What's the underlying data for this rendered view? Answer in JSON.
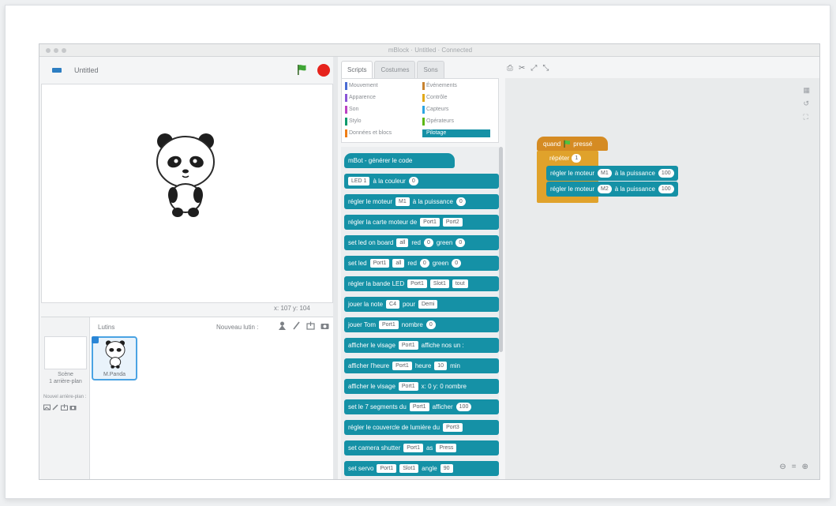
{
  "window": {
    "title": "mBlock · Untitled · Connected"
  },
  "stage": {
    "project_name": "Untitled",
    "coords": "x: 107  y: 104"
  },
  "sprites": {
    "title": "Lutins",
    "new_sprite_label": "Nouveau lutin :",
    "stage_label": "Scène\n1 arrière-plan",
    "bg_label": "Nouvel arrière-plan :",
    "items": [
      {
        "name": "M.Panda"
      }
    ]
  },
  "tabs": [
    {
      "label": "Scripts",
      "active": true
    },
    {
      "label": "Costumes",
      "active": false
    },
    {
      "label": "Sons",
      "active": false
    }
  ],
  "categories": [
    {
      "label": "Mouvement",
      "color": "#4a6cd4",
      "selected": false
    },
    {
      "label": "Apparence",
      "color": "#8a55d7",
      "selected": false
    },
    {
      "label": "Son",
      "color": "#bb42c3",
      "selected": false
    },
    {
      "label": "Stylo",
      "color": "#0e9a6c",
      "selected": false
    },
    {
      "label": "Données et blocs",
      "color": "#ee7d16",
      "selected": false
    },
    {
      "label": "Événements",
      "color": "#c88330",
      "selected": false
    },
    {
      "label": "Contrôle",
      "color": "#e1a91a",
      "selected": false
    },
    {
      "label": "Capteurs",
      "color": "#2ca5e2",
      "selected": false
    },
    {
      "label": "Opérateurs",
      "color": "#5cb712",
      "selected": false
    },
    {
      "label": "Pilotage",
      "color": "#1591a6",
      "selected": true
    }
  ],
  "palette": {
    "blocks": [
      {
        "parts": [
          {
            "t": "mBot - générer le code"
          }
        ]
      },
      {
        "parts": [
          {
            "s": "LED 1",
            "dd": true
          },
          {
            "t": "à la couleur"
          },
          {
            "s": "0"
          }
        ]
      },
      {
        "parts": [
          {
            "t": "régler le moteur"
          },
          {
            "s": "M1",
            "dd": true
          },
          {
            "t": "à la puissance"
          },
          {
            "s": "0"
          }
        ]
      },
      {
        "parts": [
          {
            "t": "régler la carte moteur de"
          },
          {
            "s": "Port1",
            "dd": true
          },
          {
            "s": "Port2",
            "dd": true
          }
        ]
      },
      {
        "parts": [
          {
            "t": "set led on board"
          },
          {
            "s": "all",
            "dd": true
          },
          {
            "t": "red"
          },
          {
            "s": "0"
          },
          {
            "t": "green"
          },
          {
            "s": "0"
          }
        ]
      },
      {
        "parts": [
          {
            "t": "set led"
          },
          {
            "s": "Port1",
            "dd": true
          },
          {
            "s": "all",
            "dd": true
          },
          {
            "t": "red"
          },
          {
            "s": "0"
          },
          {
            "t": "green"
          },
          {
            "s": "0"
          }
        ]
      },
      {
        "parts": [
          {
            "t": "régler la bande LED"
          },
          {
            "s": "Port1",
            "dd": true
          },
          {
            "s": "Slot1",
            "dd": true
          },
          {
            "s": "tout",
            "dd": true
          }
        ]
      },
      {
        "parts": [
          {
            "t": "jouer la note"
          },
          {
            "s": "C4",
            "dd": true
          },
          {
            "t": "pour"
          },
          {
            "s": "Demi",
            "dd": true
          }
        ]
      },
      {
        "parts": [
          {
            "t": "jouer Tom"
          },
          {
            "s": "Port1",
            "dd": true
          },
          {
            "t": "nombre"
          },
          {
            "s": "0"
          }
        ]
      },
      {
        "parts": [
          {
            "t": "afficher le visage"
          },
          {
            "s": "Port1",
            "dd": true
          },
          {
            "t": "affiche nos un :"
          }
        ]
      },
      {
        "parts": [
          {
            "t": "afficher l'heure"
          },
          {
            "s": "Port1",
            "dd": true
          },
          {
            "t": "heure"
          },
          {
            "s": "10",
            "dd": true
          },
          {
            "t": "min"
          }
        ]
      },
      {
        "parts": [
          {
            "t": "afficher le visage"
          },
          {
            "s": "Port1",
            "dd": true
          },
          {
            "t": "x: 0 y: 0 nombre"
          }
        ]
      },
      {
        "parts": [
          {
            "t": "set le 7 segments du"
          },
          {
            "s": "Port1",
            "dd": true
          },
          {
            "t": "afficher"
          },
          {
            "s": "100"
          }
        ]
      },
      {
        "parts": [
          {
            "t": "régler le couvercle de lumière du"
          },
          {
            "s": "Port3",
            "dd": true
          }
        ]
      },
      {
        "parts": [
          {
            "t": "set camera shutter"
          },
          {
            "s": "Port1",
            "dd": true
          },
          {
            "t": "as"
          },
          {
            "s": "Press",
            "dd": true
          }
        ]
      },
      {
        "parts": [
          {
            "t": "set servo"
          },
          {
            "s": "Port1",
            "dd": true
          },
          {
            "s": "Slot1",
            "dd": true
          },
          {
            "t": "angle"
          },
          {
            "s": "90",
            "dd": true
          }
        ]
      }
    ]
  },
  "script": {
    "hat_prefix": "quand",
    "hat_suffix": "pressé",
    "loop_label": "répéter",
    "loop_count": "1",
    "blocks": [
      {
        "before": "régler le moteur",
        "slot1": "M1",
        "mid": "à la puissance",
        "slot2": "100"
      },
      {
        "before": "régler le moteur",
        "slot1": "M2",
        "mid": "à la puissance",
        "slot2": "100"
      }
    ]
  },
  "colors": {
    "pilotage": "#1591a6",
    "events": "#d58b23",
    "control": "#e0a22b",
    "stop": "#e6231c",
    "flag": "#3fa535"
  }
}
